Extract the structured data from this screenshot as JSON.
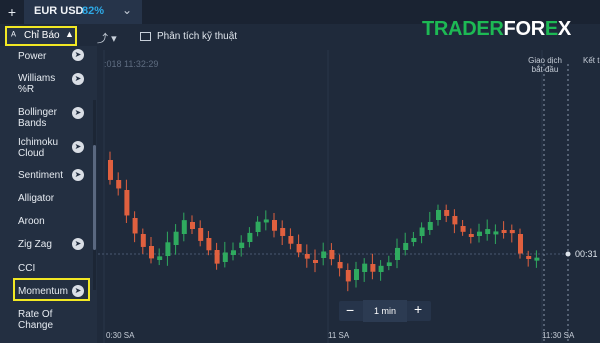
{
  "tabbar": {
    "plus": "+",
    "asset": "EUR USD",
    "payout": "82%",
    "chevron": "⌄"
  },
  "toolbar": {
    "indicators_label": "Chỉ Báo",
    "indicators_caret": "▲",
    "draw_icon": "⤴",
    "draw_caret": "▾",
    "analysis_label": "Phân tích kỹ thuật"
  },
  "logo": {
    "part1": "TRADER",
    "part2": "FOR",
    "part3": "E",
    "part4": "X"
  },
  "sidebar": {
    "items": [
      {
        "label": "Power"
      },
      {
        "label": "Williams %R"
      },
      {
        "label": "Bollinger Bands"
      },
      {
        "label": "Ichimoku Cloud"
      },
      {
        "label": "Sentiment"
      },
      {
        "label": "Alligator"
      },
      {
        "label": "Aroon"
      },
      {
        "label": "Zig Zag"
      },
      {
        "label": "CCI"
      },
      {
        "label": "Momentum"
      },
      {
        "label": "Rate Of Change"
      }
    ],
    "arrow_glyph": "➤"
  },
  "chart": {
    "time_readout": ":018 11:32:29",
    "start_marker": "Giao dịch bắt đầu",
    "end_marker": "Kết th giao d",
    "current_price": "00:31",
    "x_ticks": [
      "0:30 SA",
      "11 SA",
      "11:30 SA"
    ],
    "colors": {
      "up": "#2faa5f",
      "down": "#e0603f",
      "background": "#1f2a3b"
    }
  },
  "timeframe": {
    "minus": "−",
    "label": "1 min",
    "plus": "+"
  }
}
